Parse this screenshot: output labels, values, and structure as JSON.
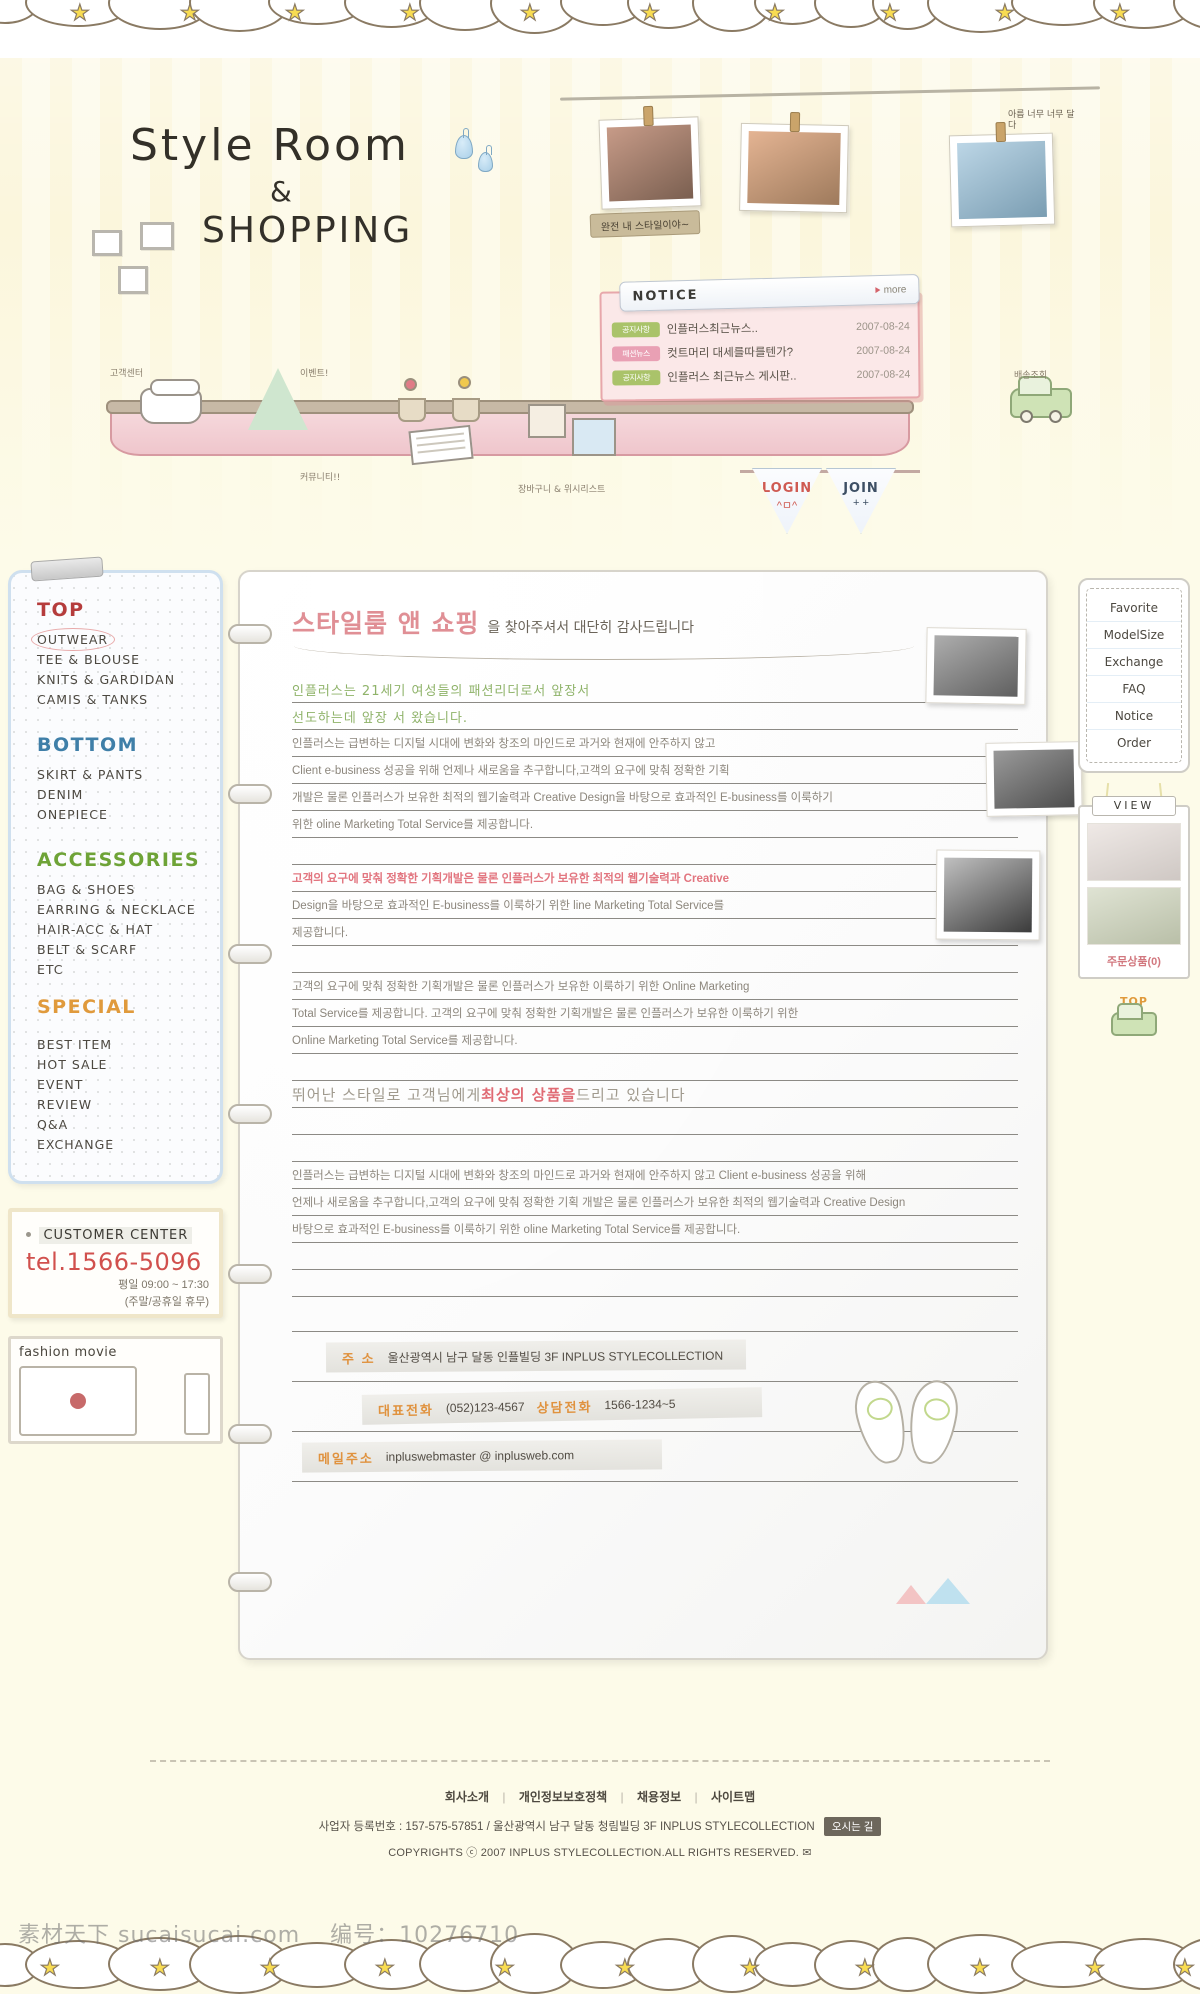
{
  "site": {
    "logo_line1": "Style Room",
    "logo_line2": "&",
    "logo_line3": "SHOPPING"
  },
  "header": {
    "photo_caption": "완전 내 스타일이야~",
    "photo_caption2": "아름 너무 너무 달다",
    "login_label": "LOGIN",
    "login_face": "^ㅁ^",
    "join_label": "JOIN",
    "join_face": "+ +",
    "join_face2": "-",
    "deco_customer": "고객센터",
    "deco_event": "이벤트!",
    "deco_community": "커뮤니티!!",
    "deco_shopping": "장바구니 & 위시리스트",
    "deco_delivery": "배송조회"
  },
  "notice": {
    "title": "NOTICE",
    "more_label": "more",
    "items": [
      {
        "badge": "공지사항",
        "badge_type": "green",
        "title": "인플러스최근뉴스..",
        "icon": "tv-icon",
        "date": "2007-08-24"
      },
      {
        "badge": "패션뉴스",
        "badge_type": "pink",
        "title": "컷트머리 대세를따를텐가?",
        "icon": "",
        "date": "2007-08-24"
      },
      {
        "badge": "공지사항",
        "badge_type": "green",
        "title": "인플러스 최근뉴스 게시판..",
        "icon": "",
        "date": "2007-08-24"
      }
    ]
  },
  "sidebar": {
    "groups": [
      {
        "title": "TOP",
        "color": "#b53c3c",
        "items": [
          {
            "label": "OUTWEAR",
            "active": true
          },
          {
            "label": "TEE & BLOUSE",
            "active": false
          },
          {
            "label": "KNITS & GARDIDAN",
            "active": false
          },
          {
            "label": "CAMIS & TANKS",
            "active": false
          }
        ]
      },
      {
        "title": "BOTTOM",
        "color": "#3f7fa8",
        "items": [
          {
            "label": "SKIRT & PANTS",
            "active": false
          },
          {
            "label": "DENIM",
            "active": false
          },
          {
            "label": "ONEPIECE",
            "active": false
          }
        ]
      },
      {
        "title": "ACCESSORIES",
        "color": "#6ea337",
        "items": [
          {
            "label": "BAG & SHOES",
            "active": false
          },
          {
            "label": "EARRING & NECKLACE",
            "active": false
          },
          {
            "label": "HAIR-ACC & HAT",
            "active": false
          },
          {
            "label": "BELT & SCARF",
            "active": false
          },
          {
            "label": "ETC",
            "active": false
          }
        ]
      },
      {
        "title": "SPECIAL",
        "color": "#e09a3c",
        "items": [
          {
            "label": "BEST ITEM",
            "active": false
          },
          {
            "label": "HOT SALE",
            "active": false
          },
          {
            "label": "EVENT",
            "active": false
          },
          {
            "label": "REVIEW",
            "active": false
          },
          {
            "label": "Q&A",
            "active": false
          },
          {
            "label": "EXCHANGE",
            "active": false
          }
        ]
      }
    ]
  },
  "customer_center": {
    "title": "CUSTOMER CENTER",
    "tel": "tel.1566-5096",
    "hours_line1": "평일 09:00 ~ 17:30",
    "hours_line2": "(주말/공휴일 휴무)"
  },
  "fashion_movie": {
    "title": "fashion movie"
  },
  "main": {
    "welcome_highlight": "스타일룸 앤 쇼핑",
    "welcome_rest": "을 찾아주셔서 대단히 감사드립니다",
    "intro_hand_line1": "인플러스는 21세기 여성들의 패션리더로서 앞장서",
    "intro_hand_line2": "선도하는데 앞장 서 왔습니다.",
    "paragraph1": [
      "인플러스는 급변하는 디지털 시대에 변화와 창조의 마인드로 과거와 현재에 안주하지 않고",
      "Client e-business  성공을 위해 언제나 새로움을 추구합니다,고객의 요구에 맞춰 정확한 기획",
      "개발은 물론 인플러스가 보유한 최적의 웹기술력과 Creative Design을 바탕으로 효과적인 E-business를 이룩하기",
      "위한 oline Marketing Total Service를 제공합니다."
    ],
    "paragraph2_red": "고객의 요구에 맞춰 정확한 기획개발은 물론 인플러스가 보유한 최적의 웹기술력과  Creative",
    "paragraph2": [
      "Design을  바탕으로 효과적인 E-business를 이룩하기 위한 line Marketing Total Service를",
      "제공합니다."
    ],
    "paragraph3": [
      "고객의 요구에 맞춰 정확한 기획개발은 물론 인플러스가 보유한  이룩하기 위한 Online Marketing",
      "Total Service를 제공합니다. 고객의 요구에 맞춰 정확한 기획개발은 물론 인플러스가 보유한  이룩하기 위한",
      "Online Marketing Total Service를 제공합니다."
    ],
    "hand_headline_pre": "뛰어난 스타일로 고객님에게 ",
    "hand_headline_hl": "최상의 상품을",
    "hand_headline_post": " 드리고 있습니다",
    "paragraph4": [
      "인플러스는 급변하는 디지털 시대에 변화와 창조의 마인드로 과거와 현재에 안주하지 않고  Client e-business  성공을 위해",
      "언제나 새로움을 추구합니다,고객의 요구에 맞춰 정확한 기획 개발은 물론 인플러스가 보유한 최적의 웹기술력과 Creative Design",
      "바탕으로 효과적인 E-business를 이룩하기 위한 oline Marketing Total Service를 제공합니다."
    ],
    "contact": {
      "address_label": "주 소",
      "address_value": "울산광역시 남구 달동 인플빌딩 3F INPLUS STYLECOLLECTION",
      "tel_label": "대표전화",
      "tel_value": "(052)123-4567",
      "consult_label": "상담전화",
      "consult_value": "1566-1234~5",
      "email_label": "메일주소",
      "email_value": "inpluswebmaster @ inplusweb.com"
    }
  },
  "quick_menu": {
    "items": [
      "Favorite",
      "ModelSize",
      "Exchange",
      "FAQ",
      "Notice",
      "Order"
    ]
  },
  "view_panel": {
    "title": "VIEW",
    "cart_label": "주문상품(0)",
    "top_label": "TOP"
  },
  "footer": {
    "links": [
      "회사소개",
      "개인정보보호정책",
      "채용정보",
      "사이트맵"
    ],
    "business_info": "사업자 등록번호 : 157-575-57851 / 울산광역시 남구 달동 청림빌딩 3F INPLUS STYLECOLLECTION",
    "map_button": "오시는 길",
    "copyright": "COPYRIGHTS ⓒ 2007 INPLUS STYLECOLLECTION.ALL RIGHTS RESERVED. ✉"
  },
  "watermark": {
    "site": "素材天下 sucaisucai.com",
    "number": "编号：10276710"
  },
  "colors": {
    "accent_pink": "#e08f95",
    "accent_red": "#d1504d",
    "accent_orange": "#e09a3c",
    "accent_green": "#6ea337",
    "accent_blue": "#3f7fa8",
    "bg": "#fdfbe9"
  }
}
